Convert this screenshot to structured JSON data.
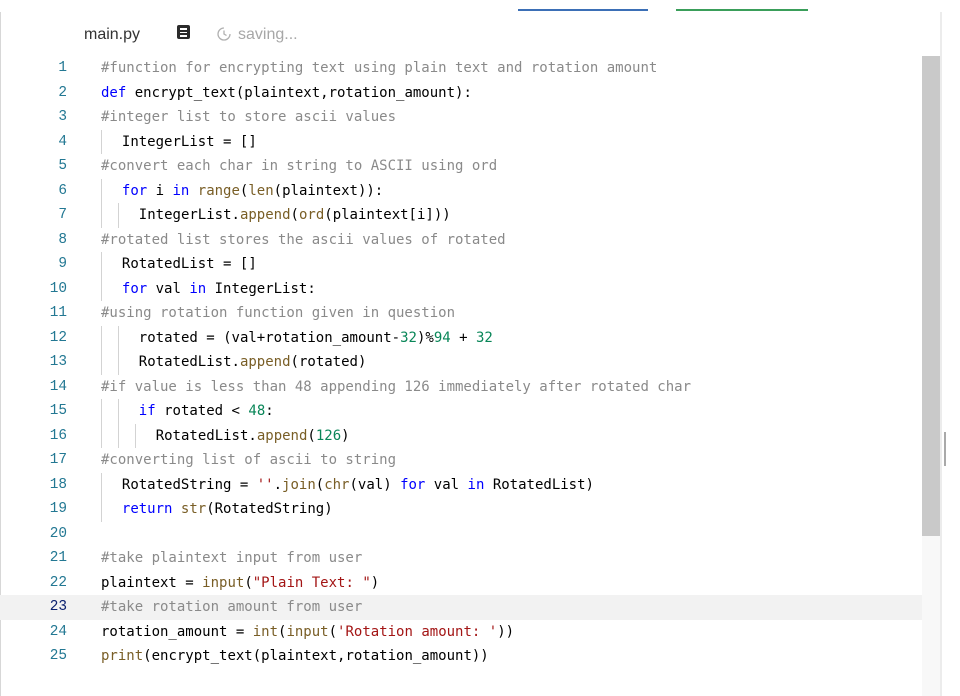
{
  "tab": {
    "filename": "main.py",
    "save_status": "saving...",
    "file_icon": "document-icon",
    "save_icon": "sync-icon"
  },
  "editor": {
    "active_line": 23,
    "lines": [
      {
        "n": "1",
        "indent": 0,
        "tokens": [
          [
            "c",
            "#function for encrypting text using plain text and rotation amount"
          ]
        ]
      },
      {
        "n": "2",
        "indent": 0,
        "tokens": [
          [
            "k",
            "def "
          ],
          [
            "p",
            "encrypt_text(plaintext,rotation_amount):"
          ]
        ]
      },
      {
        "n": "3",
        "indent": 0,
        "tokens": [
          [
            "c",
            "#integer list to store ascii values"
          ]
        ]
      },
      {
        "n": "4",
        "indent": 1,
        "tokens": [
          [
            "p",
            "IntegerList = []"
          ]
        ]
      },
      {
        "n": "5",
        "indent": 0,
        "tokens": [
          [
            "c",
            "#convert each char in string to ASCII using ord"
          ]
        ]
      },
      {
        "n": "6",
        "indent": 1,
        "tokens": [
          [
            "k",
            "for "
          ],
          [
            "p",
            "i "
          ],
          [
            "k",
            "in "
          ],
          [
            "b",
            "range"
          ],
          [
            "p",
            "("
          ],
          [
            "b",
            "len"
          ],
          [
            "p",
            "(plaintext)):"
          ]
        ]
      },
      {
        "n": "7",
        "indent": 2,
        "tokens": [
          [
            "p",
            "IntegerList."
          ],
          [
            "f",
            "append"
          ],
          [
            "p",
            "("
          ],
          [
            "b",
            "ord"
          ],
          [
            "p",
            "(plaintext[i]))"
          ]
        ]
      },
      {
        "n": "8",
        "indent": 0,
        "tokens": [
          [
            "c",
            "#rotated list stores the ascii values of rotated"
          ]
        ]
      },
      {
        "n": "9",
        "indent": 1,
        "tokens": [
          [
            "p",
            "RotatedList = []"
          ]
        ]
      },
      {
        "n": "10",
        "indent": 1,
        "tokens": [
          [
            "k",
            "for "
          ],
          [
            "p",
            "val "
          ],
          [
            "k",
            "in "
          ],
          [
            "p",
            "IntegerList:"
          ]
        ]
      },
      {
        "n": "11",
        "indent": 0,
        "tokens": [
          [
            "c",
            "#using rotation function given in question"
          ]
        ]
      },
      {
        "n": "12",
        "indent": 2,
        "tokens": [
          [
            "p",
            "rotated = (val+rotation_amount-"
          ],
          [
            "n",
            "32"
          ],
          [
            "p",
            ")%"
          ],
          [
            "n",
            "94"
          ],
          [
            "p",
            " + "
          ],
          [
            "n",
            "32"
          ]
        ]
      },
      {
        "n": "13",
        "indent": 2,
        "tokens": [
          [
            "p",
            "RotatedList."
          ],
          [
            "f",
            "append"
          ],
          [
            "p",
            "(rotated)"
          ]
        ]
      },
      {
        "n": "14",
        "indent": 0,
        "tokens": [
          [
            "c",
            "#if value is less than 48 appending 126 immediately after rotated char"
          ]
        ]
      },
      {
        "n": "15",
        "indent": 2,
        "tokens": [
          [
            "k",
            "if "
          ],
          [
            "p",
            "rotated < "
          ],
          [
            "n",
            "48"
          ],
          [
            "p",
            ":"
          ]
        ]
      },
      {
        "n": "16",
        "indent": 3,
        "tokens": [
          [
            "p",
            "RotatedList."
          ],
          [
            "f",
            "append"
          ],
          [
            "p",
            "("
          ],
          [
            "n",
            "126"
          ],
          [
            "p",
            ")"
          ]
        ]
      },
      {
        "n": "17",
        "indent": 0,
        "tokens": [
          [
            "c",
            "#converting list of ascii to string"
          ]
        ]
      },
      {
        "n": "18",
        "indent": 1,
        "tokens": [
          [
            "p",
            "RotatedString = "
          ],
          [
            "s",
            "''"
          ],
          [
            "p",
            "."
          ],
          [
            "f",
            "join"
          ],
          [
            "p",
            "("
          ],
          [
            "b",
            "chr"
          ],
          [
            "p",
            "(val) "
          ],
          [
            "k",
            "for "
          ],
          [
            "p",
            "val "
          ],
          [
            "k",
            "in "
          ],
          [
            "p",
            "RotatedList)"
          ]
        ]
      },
      {
        "n": "19",
        "indent": 1,
        "tokens": [
          [
            "k",
            "return "
          ],
          [
            "b",
            "str"
          ],
          [
            "p",
            "(RotatedString)"
          ]
        ]
      },
      {
        "n": "20",
        "indent": 0,
        "tokens": []
      },
      {
        "n": "21",
        "indent": 0,
        "tokens": [
          [
            "c",
            "#take plaintext input from user"
          ]
        ]
      },
      {
        "n": "22",
        "indent": 0,
        "tokens": [
          [
            "p",
            "plaintext = "
          ],
          [
            "b",
            "input"
          ],
          [
            "p",
            "("
          ],
          [
            "s",
            "\"Plain Text: \""
          ],
          [
            "p",
            ")"
          ]
        ]
      },
      {
        "n": "23",
        "indent": 0,
        "tokens": [
          [
            "c",
            "#take rotation amount from user"
          ]
        ]
      },
      {
        "n": "24",
        "indent": 0,
        "tokens": [
          [
            "p",
            "rotation_amount = "
          ],
          [
            "b",
            "int"
          ],
          [
            "p",
            "("
          ],
          [
            "b",
            "input"
          ],
          [
            "p",
            "("
          ],
          [
            "s",
            "'Rotation amount: '"
          ],
          [
            "p",
            "))"
          ]
        ]
      },
      {
        "n": "25",
        "indent": 0,
        "tokens": [
          [
            "b",
            "print"
          ],
          [
            "p",
            "(encrypt_text(plaintext,rotation_amount))"
          ]
        ]
      }
    ]
  }
}
